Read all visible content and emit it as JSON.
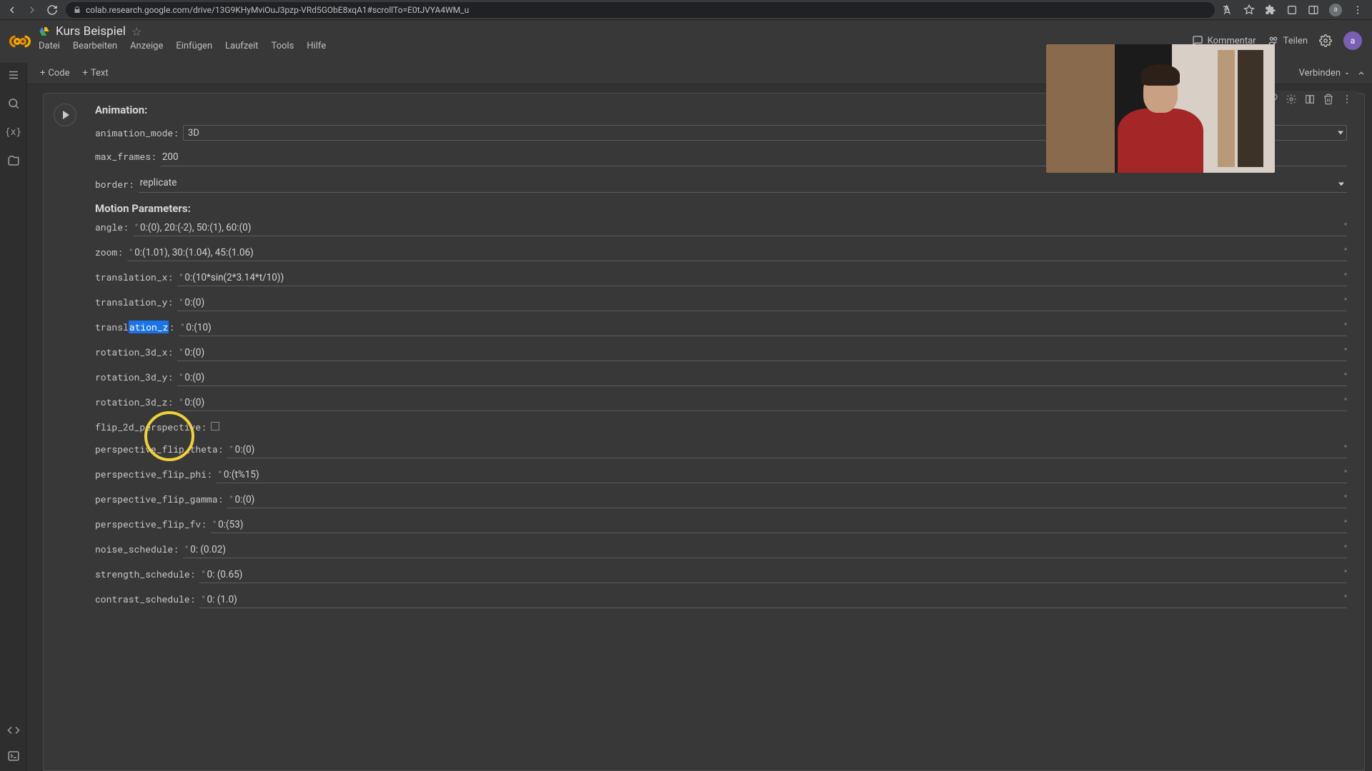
{
  "browser": {
    "url": "colab.research.google.com/drive/13G9KHyMviOuJ3pzp-VRd5GObE8xqA1#scrollTo=E0tJVYA4WM_u",
    "avatar_letter": "a"
  },
  "header": {
    "doc_title": "Kurs Beispiel",
    "menus": [
      "Datei",
      "Bearbeiten",
      "Anzeige",
      "Einfügen",
      "Laufzeit",
      "Tools",
      "Hilfe"
    ],
    "comment_label": "Kommentar",
    "share_label": "Teilen",
    "avatar_letter": "a"
  },
  "toolbar": {
    "add_code": "Code",
    "add_text": "Text",
    "connect_label": "Verbinden"
  },
  "form": {
    "section_animation": "Animation:",
    "section_motion": "Motion Parameters:",
    "params": {
      "animation_mode": {
        "label": "animation_mode:",
        "value": "3D"
      },
      "max_frames": {
        "label": "max_frames:",
        "value": "200"
      },
      "border": {
        "label": "border:",
        "value": "replicate"
      },
      "angle": {
        "label": "angle:",
        "value": "0:(0), 20:(-2), 50:(1), 60:(0)"
      },
      "zoom": {
        "label": "zoom:",
        "value": "0:(1.01), 30:(1.04), 45:(1.06)"
      },
      "translation_x": {
        "label": "translation_x:",
        "value": "0:(10*sin(2*3.14*t/10))"
      },
      "translation_y": {
        "label": "translation_y:",
        "value": "0:(0)"
      },
      "translation_z": {
        "label_pre": "transl",
        "label_hl": "ation_z",
        "label_post": ":",
        "value": "0:(10)"
      },
      "rotation_3d_x": {
        "label": "rotation_3d_x:",
        "value": "0:(0)"
      },
      "rotation_3d_y": {
        "label": "rotation_3d_y:",
        "value": "0:(0)"
      },
      "rotation_3d_z": {
        "label": "rotation_3d_z:",
        "value": "0:(0)"
      },
      "flip_2d_perspective": {
        "label": "flip_2d_perspective:",
        "checked": false
      },
      "perspective_flip_theta": {
        "label": "perspective_flip_theta:",
        "value": "0:(0)"
      },
      "perspective_flip_phi": {
        "label": "perspective_flip_phi:",
        "value": "0:(t%15)"
      },
      "perspective_flip_gamma": {
        "label": "perspective_flip_gamma:",
        "value": "0:(0)"
      },
      "perspective_flip_fv": {
        "label": "perspective_flip_fv:",
        "value": "0:(53)"
      },
      "noise_schedule": {
        "label": "noise_schedule:",
        "value": "0: (0.02)"
      },
      "strength_schedule": {
        "label": "strength_schedule:",
        "value": "0: (0.65)"
      },
      "contrast_schedule": {
        "label": "contrast_schedule:",
        "value": "0: (1.0)"
      }
    }
  }
}
